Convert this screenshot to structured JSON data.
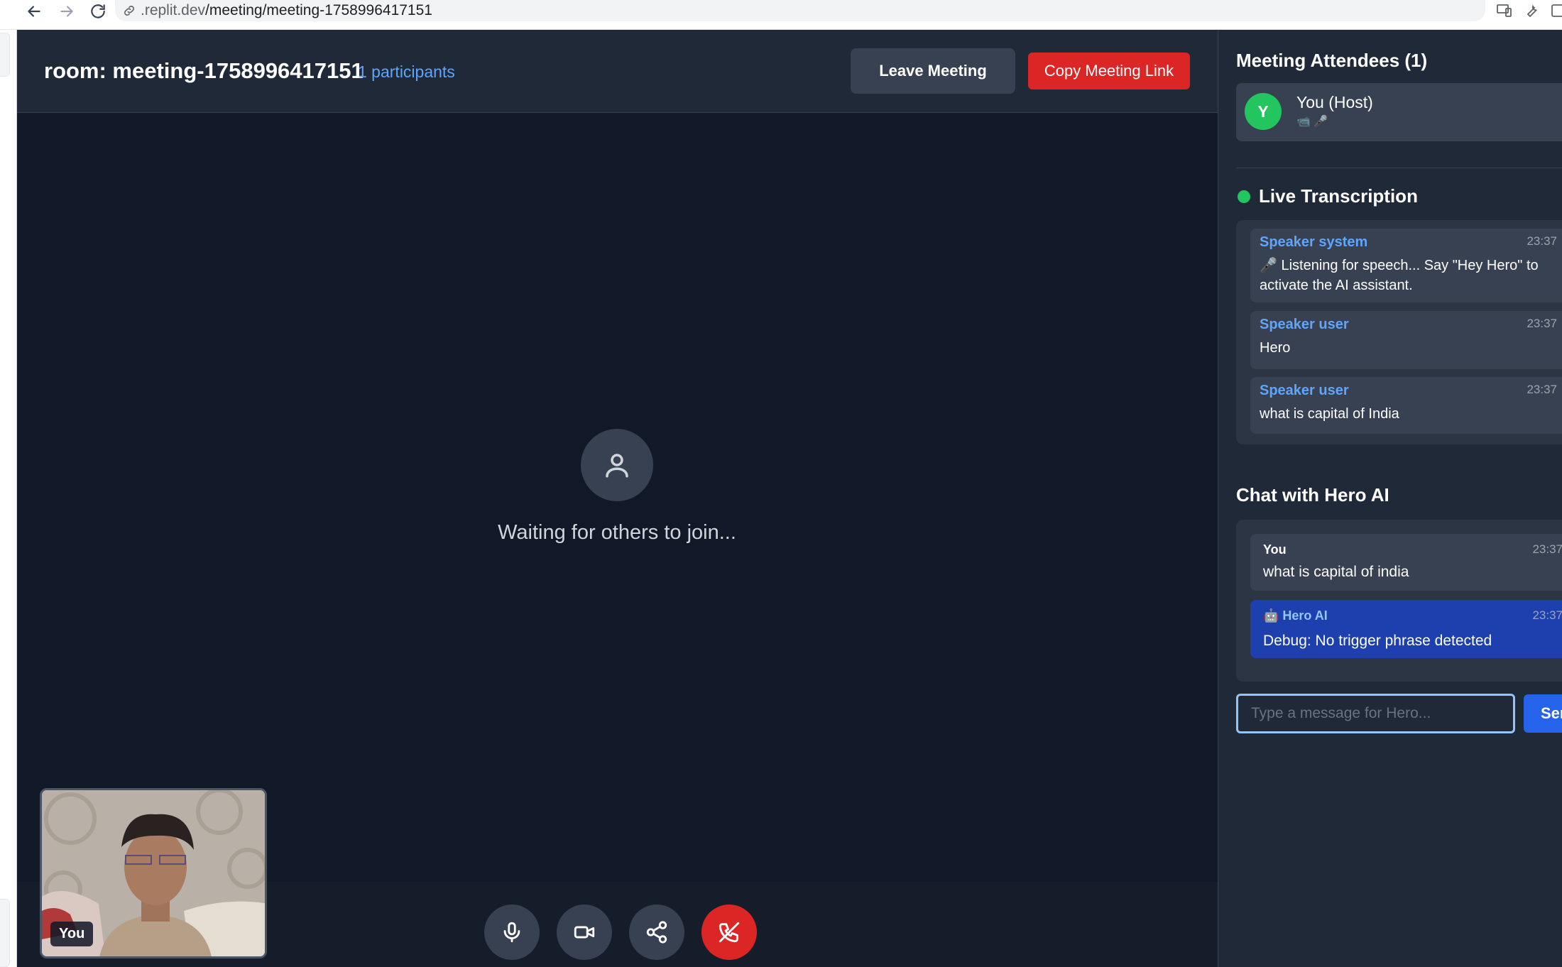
{
  "browser": {
    "url_host": ".replit.dev",
    "url_path": "/meeting/meeting-1758996417151"
  },
  "header": {
    "room_title": "room: meeting-1758996417151",
    "participants": "1 participants",
    "leave_label": "Leave Meeting",
    "copy_label": "Copy Meeting Link"
  },
  "stage": {
    "waiting_text": "Waiting for others to join...",
    "self_label": "You"
  },
  "controls": [
    "microphone-icon",
    "video-camera-icon",
    "share-icon",
    "end-call-icon"
  ],
  "sidebar": {
    "attendees_heading": "Meeting Attendees (1)",
    "attendee": {
      "initial": "Y",
      "name": "You (Host)",
      "status": "📹 🎤"
    },
    "transcription_heading": "Live Transcription",
    "transcripts": [
      {
        "speaker": "Speaker system",
        "time": "23:37",
        "text": "🎤 Listening for speech... Say \"Hey Hero\" to activate the AI assistant."
      },
      {
        "speaker": "Speaker user",
        "time": "23:37",
        "text": "Hero"
      },
      {
        "speaker": "Speaker user",
        "time": "23:37",
        "text": "what is capital of India"
      }
    ],
    "chat_heading": "Chat with Hero AI",
    "chat": [
      {
        "name": "You",
        "time": "23:37",
        "text": "what is capital of india"
      },
      {
        "name": "🤖 Hero AI",
        "time": "23:37",
        "text": "Debug: No trigger phrase detected"
      }
    ],
    "input_placeholder": "Type a message for Hero...",
    "send_label": "Send"
  },
  "colors": {
    "app_bg": "#111827",
    "panel_bg": "#1f2937",
    "accent_blue": "#2563eb",
    "link_blue": "#60a5fa",
    "danger_red": "#dc2626",
    "live_green": "#22c55e"
  }
}
